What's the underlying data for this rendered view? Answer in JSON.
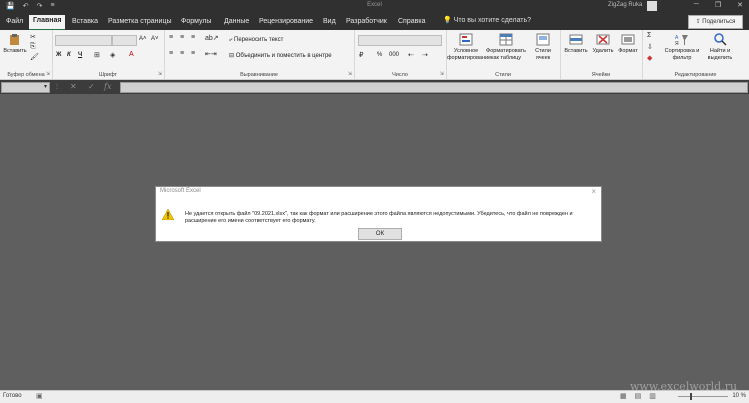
{
  "window": {
    "title": "Excel",
    "user": "ZigZag Ruka",
    "quick_access": [
      "💾",
      "↶",
      "↷",
      "≡"
    ],
    "controls": [
      "─",
      "❐",
      "✕"
    ]
  },
  "ribbon_tabs": [
    "Файл",
    "Главная",
    "Вставка",
    "Разметка страницы",
    "Формулы",
    "Данные",
    "Рецензирование",
    "Вид",
    "Разработчик",
    "Справка"
  ],
  "active_tab": "Главная",
  "tell_me": "Что вы хотите сделать?",
  "share": "Поделиться",
  "groups": {
    "clipboard": {
      "label": "Буфер обмена",
      "paste": "Вставить"
    },
    "font": {
      "label": "Шрифт",
      "bold": "Ж",
      "italic": "К",
      "underline": "Ч",
      "grow": "A˄",
      "shrink": "A˅"
    },
    "alignment": {
      "label": "Выравнивание",
      "wrap": "Переносить текст",
      "merge": "Объединить и поместить в центре"
    },
    "number": {
      "label": "Число",
      "percent": "%",
      "thousands": "000"
    },
    "styles": {
      "label": "Стили",
      "conditional": "Условное форматирование",
      "as_table": "Форматировать как таблицу",
      "cell_styles": "Стили ячеек"
    },
    "cells": {
      "label": "Ячейки",
      "insert": "Вставить",
      "delete": "Удалить",
      "format": "Формат"
    },
    "editing": {
      "label": "Редактирование",
      "sort": "Сортировка и фильтр",
      "find": "Найти и выделить"
    }
  },
  "formula_bar": {
    "cancel": "✕",
    "enter": "✓",
    "fx": "fx",
    "more": "⋮"
  },
  "dialog": {
    "title": "Microsoft Excel",
    "message": "Не удается открыть файл \"09.2021.xlsx\", так как формат или расширение этого файла являются недопустимыми. Убедитесь, что файл не поврежден и расширение его имени соответствует его формату.",
    "ok": "ОК"
  },
  "status": {
    "ready": "Готово",
    "zoom": "10 %"
  },
  "watermark": "www.excelworld.ru",
  "colors": {
    "accent": "#217346",
    "warning": "#f2c300"
  }
}
